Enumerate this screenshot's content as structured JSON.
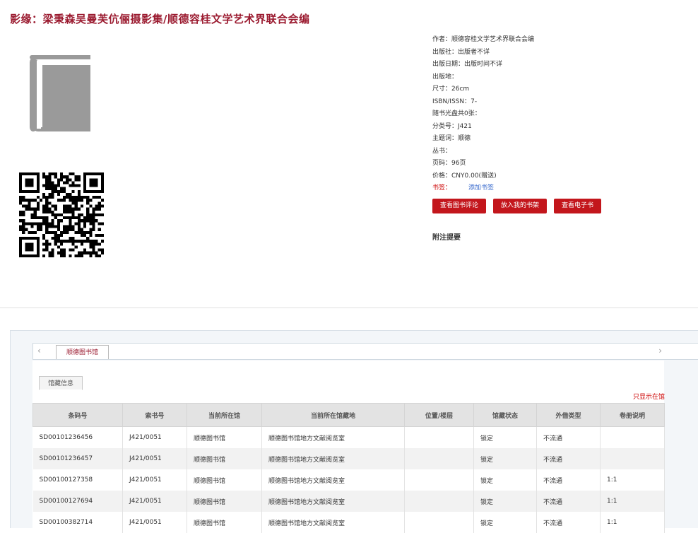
{
  "title": "影缘：梁秉森吴曼芙伉俪摄影集/顺德容桂文学艺术界联合会编",
  "info": [
    "作者：顺德容桂文学艺术界联合会编",
    "出版社：出版者不详",
    "出版日期：出版时间不详",
    "出版地：",
    "尺寸：26cm",
    "ISBN/ISSN：7-",
    "随书光盘共0张：",
    "分类号：J421",
    "主题词：顺德",
    "丛书：",
    "页码：96页",
    "价格：CNY0.00(赠送)"
  ],
  "bookmark": {
    "label": "书签：",
    "link": "添加书签"
  },
  "buttons": {
    "review": "查看图书评论",
    "shelf": "放入我的书架",
    "ebook": "查看电子书"
  },
  "annotation": "附注提要",
  "tabs": {
    "library": "顺德图书馆",
    "holdings": "馆藏信息"
  },
  "only_this_library": "只显示在馆",
  "table": {
    "headers": [
      "条码号",
      "索书号",
      "当前所在馆",
      "当前所在馆藏地",
      "位置/楼层",
      "馆藏状态",
      "外借类型",
      "卷册说明"
    ],
    "rows": [
      [
        "SD00101236456",
        "J421/0051",
        "顺德图书馆",
        "顺德图书馆地方文献阅览室",
        "",
        "锁定",
        "不流通",
        ""
      ],
      [
        "SD00101236457",
        "J421/0051",
        "顺德图书馆",
        "顺德图书馆地方文献阅览室",
        "",
        "锁定",
        "不流通",
        ""
      ],
      [
        "SD00100127358",
        "J421/0051",
        "顺德图书馆",
        "顺德图书馆地方文献阅览室",
        "",
        "锁定",
        "不流通",
        "1:1"
      ],
      [
        "SD00100127694",
        "J421/0051",
        "顺德图书馆",
        "顺德图书馆地方文献阅览室",
        "",
        "锁定",
        "不流通",
        "1:1"
      ],
      [
        "SD00100382714",
        "J421/0051",
        "顺德图书馆",
        "顺德图书馆地方文献阅览室",
        "",
        "锁定",
        "不流通",
        "1:1"
      ]
    ]
  },
  "icons": {
    "cover": "book-icon",
    "qr": "qr-code-icon",
    "left": "chevron-left-icon",
    "right": "chevron-right-icon"
  },
  "colors": {
    "title": "#9b1b30",
    "button": "#c3161c",
    "link": "#3366cc"
  }
}
